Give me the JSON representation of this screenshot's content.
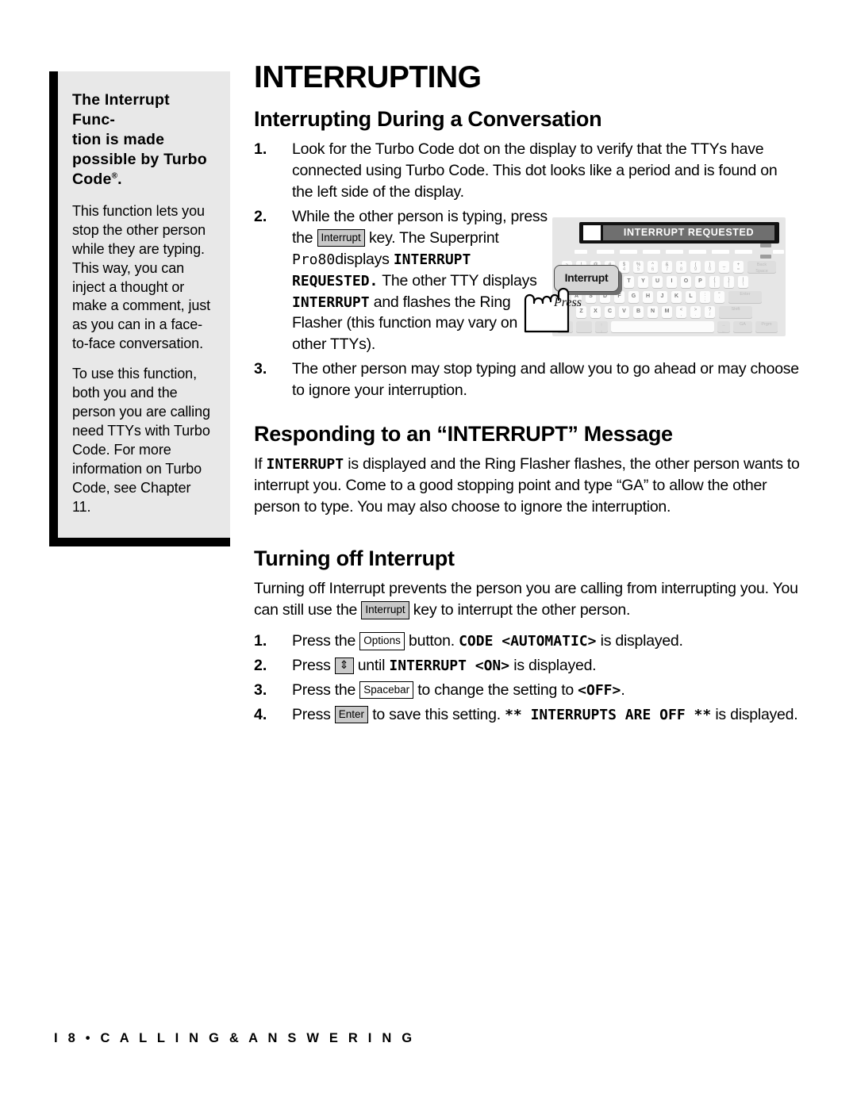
{
  "document": {
    "title": "INTERRUPTING",
    "footer": "I 8  •  C A L L I N G  &  A N S W E R I N G"
  },
  "sidebar": {
    "heading": "The Interrupt Func-tion is made possible by Turbo Code",
    "heading_lines": [
      "The Interrupt Func-",
      "tion is made",
      "possible by Turbo",
      "Code"
    ],
    "heading_superscript": "®",
    "heading_terminator": ".",
    "paragraphs": [
      "This function lets you stop the other person while they are typing. This way, you can inject a thought or make a comment, just as you can in a face-to-face conversation.",
      "To use this function, both you and the person you are calling need TTYs with Turbo Code. For more information on Turbo Code, see Chapter 11."
    ]
  },
  "sections": {
    "interrupting_during": {
      "heading": "Interrupting During a Conversation",
      "steps": [
        {
          "number": "1.",
          "text": "Look for the Turbo Code dot on the display to verify that the TTYs have connected using Turbo Code. This dot looks like a period and is found on the left side of the display."
        },
        {
          "number": "2.",
          "pre": "While the other person is typing, press the",
          "key": "Interrupt",
          "mid": "key. The Superprint",
          "model": "Pro80",
          "mid2": "displays",
          "lcd1": "INTERRUPT REQUESTED.",
          "mid3": "The other TTY displays",
          "lcd2": "INTERRUPT",
          "post": "and flashes the Ring Flasher (this function may vary on other TTYs)."
        },
        {
          "number": "3.",
          "text": "The other person may stop typing and allow you to go ahead or may choose to ignore your interruption."
        }
      ]
    },
    "responding": {
      "heading": "Responding to an “INTERRUPT” Message",
      "pre": "If",
      "lcd": "INTERRUPT",
      "post": "is displayed and the Ring Flasher flashes, the other person wants to interrupt you. Come to a good stopping point and type “GA” to allow the other person to type. You may also choose to ignore the interruption."
    },
    "turning_off": {
      "heading": "Turning off Interrupt",
      "intro_pre": "Turning off Interrupt prevents the person you are calling from interrupting you. You can still use the",
      "intro_key": "Interrupt",
      "intro_post": "key to interrupt the other person.",
      "steps": [
        {
          "number": "1.",
          "pre": "Press the",
          "key": "Options",
          "mid": "button.",
          "lcd": "CODE <AUTOMATIC>",
          "post": "is displayed."
        },
        {
          "number": "2.",
          "pre": "Press",
          "key": "⇕",
          "mid": "until",
          "lcd": "INTERRUPT <ON>",
          "post": "is displayed."
        },
        {
          "number": "3.",
          "pre": "Press the",
          "key": "Spacebar",
          "mid": "to change the setting to",
          "lcd": "<OFF>",
          "post": "."
        },
        {
          "number": "4.",
          "pre": "Press",
          "key": "Enter",
          "mid": "to save this setting.",
          "lcd": "** INTERRUPTS ARE OFF **",
          "post": "is displayed."
        }
      ]
    }
  },
  "keyboard_figure": {
    "lcd_text": "INTERRUPT REQUESTED",
    "callout_key_label": "Interrupt",
    "press_label": "Press",
    "rows": [
      {
        "keys": [
          {
            "up": "~",
            "lo": "`"
          },
          {
            "up": "!",
            "lo": "1"
          },
          {
            "up": "@",
            "lo": "2"
          },
          {
            "up": "#",
            "lo": "3"
          },
          {
            "up": "$",
            "lo": "4"
          },
          {
            "up": "%",
            "lo": "5"
          },
          {
            "up": "^",
            "lo": "6"
          },
          {
            "up": "&",
            "lo": "7"
          },
          {
            "up": "*",
            "lo": "8"
          },
          {
            "up": "(",
            "lo": "9"
          },
          {
            "up": ")",
            "lo": "0"
          },
          {
            "up": "_",
            "lo": "-"
          },
          {
            "up": "+",
            "lo": "="
          },
          {
            "label": "Back Space",
            "wide": true
          }
        ]
      },
      {
        "keys": [
          {
            "label": "Q"
          },
          {
            "label": "W"
          },
          {
            "label": "E"
          },
          {
            "label": "R"
          },
          {
            "label": "T"
          },
          {
            "label": "Y"
          },
          {
            "label": "U"
          },
          {
            "label": "I"
          },
          {
            "label": "O"
          },
          {
            "label": "P"
          },
          {
            "up": "{",
            "lo": "["
          },
          {
            "up": "}",
            "lo": "]"
          },
          {
            "up": "|",
            "lo": "\\"
          }
        ]
      },
      {
        "keys": [
          {
            "label": "A"
          },
          {
            "label": "S"
          },
          {
            "label": "D"
          },
          {
            "label": "F"
          },
          {
            "label": "G"
          },
          {
            "label": "H"
          },
          {
            "label": "J"
          },
          {
            "label": "K"
          },
          {
            "label": "L"
          },
          {
            "up": ":",
            "lo": ";"
          },
          {
            "up": "\"",
            "lo": "'"
          },
          {
            "label": "Enter",
            "wide": true
          }
        ]
      },
      {
        "keys": [
          {
            "label": "Z"
          },
          {
            "label": "X"
          },
          {
            "label": "C"
          },
          {
            "label": "V"
          },
          {
            "label": "B"
          },
          {
            "label": "N"
          },
          {
            "label": "M"
          },
          {
            "up": "<",
            "lo": ","
          },
          {
            "up": ">",
            "lo": "."
          },
          {
            "up": "?",
            "lo": "/"
          },
          {
            "label": "Shift",
            "wide": true
          }
        ]
      },
      {
        "keys": [
          {
            "label": ""
          },
          {
            "label": ""
          },
          {
            "up": "↑",
            "lo": "↓"
          },
          {
            "label": "",
            "spacebar": true
          },
          {
            "up": "→",
            "lo": "←"
          },
          {
            "label": "GA"
          },
          {
            "label": "Prgm"
          }
        ]
      }
    ]
  }
}
